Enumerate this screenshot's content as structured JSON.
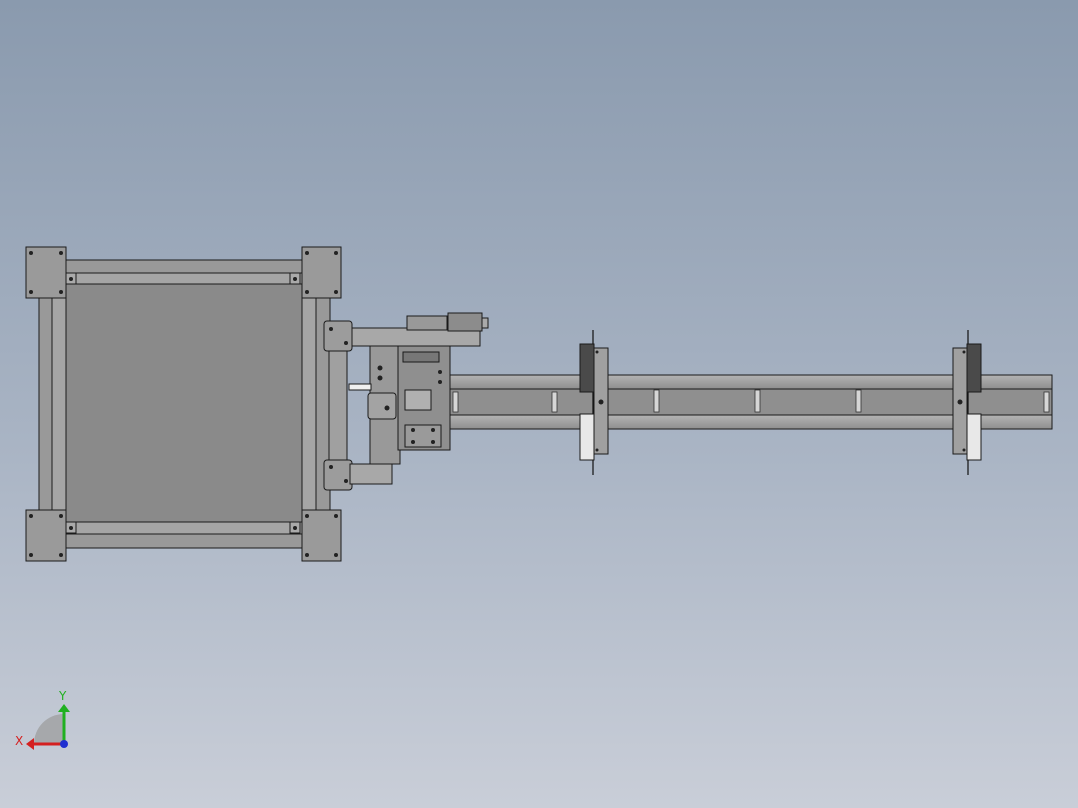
{
  "viewport": {
    "background_top": "#8a9aae",
    "background_bottom": "#c9ced8"
  },
  "model": {
    "frame_color": "#8c8c8c",
    "panel_color": "#8a8a8a",
    "outline_color": "#1a1a1a",
    "dark_block_color": "#4a4a4a",
    "light_block_color": "#e8e8e8"
  },
  "triad": {
    "x_label": "X",
    "y_label": "Y",
    "x_color": "#d42020",
    "y_color": "#20b020",
    "z_color": "#2030d0"
  }
}
